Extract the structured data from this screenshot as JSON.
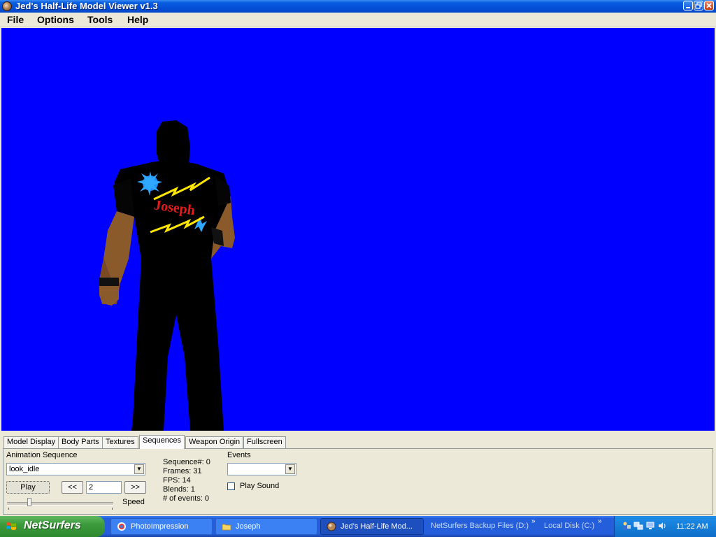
{
  "window": {
    "title": "Jed's Half-Life Model Viewer v1.3"
  },
  "menu": [
    "File",
    "Options",
    "Tools",
    "Help"
  ],
  "viewport": {
    "background": "#0000ff",
    "shirt_text": "Joseph"
  },
  "tabs": [
    "Model Display",
    "Body Parts",
    "Textures",
    "Sequences",
    "Weapon Origin",
    "Fullscreen"
  ],
  "active_tab": "Sequences",
  "sequences": {
    "animation_label": "Animation Sequence",
    "animation_value": "look_idle",
    "play_label": "Play",
    "prev_label": "<<",
    "next_label": ">>",
    "frame_value": "2",
    "speed_label": "Speed",
    "speed_level": 0.2,
    "info": {
      "sequence": "Sequence#: 0",
      "frames": "Frames: 31",
      "fps": "FPS: 14",
      "blends": "Blends: 1",
      "events": "# of events: 0"
    },
    "events_label": "Events",
    "events_value": "",
    "play_sound_label": "Play Sound",
    "play_sound_checked": false
  },
  "taskbar": {
    "start_label": "NetSurfers",
    "tasks": [
      "PhotoImpression",
      "Joseph",
      "Jed's Half-Life Mod..."
    ],
    "quick_links": [
      "NetSurfers Backup Files (D:)",
      "Local Disk (C:)"
    ],
    "clock": "11:22 AM"
  }
}
